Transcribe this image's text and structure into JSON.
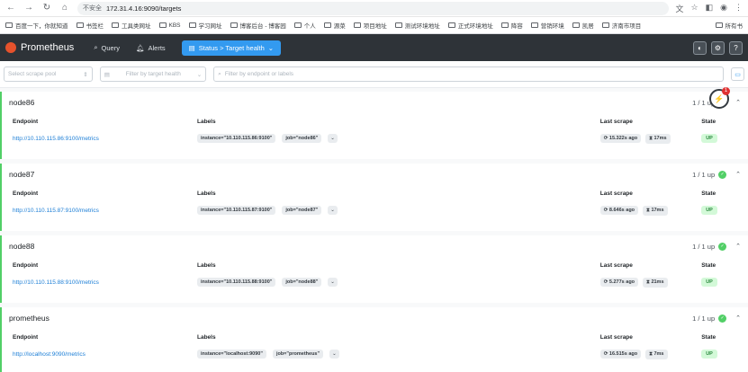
{
  "browser": {
    "url_warning": "不安全",
    "url": "172.31.4.16:9090/targets",
    "bookmarks": [
      "百度一下，你就知道",
      "书签栏",
      "工具类网址",
      "KBS",
      "学习网址",
      "博客后台 - 博客园",
      "个人",
      "源菜",
      "项目地址",
      "测试环境地址",
      "正式环境地址",
      "降容",
      "营销环境",
      "凯居",
      "济南市项目"
    ],
    "bookmarks_right": "所有书"
  },
  "navbar": {
    "brand": "Prometheus",
    "query": "Query",
    "alerts": "Alerts",
    "status": "Status > Target health"
  },
  "filters": {
    "scrape_pool_placeholder": "Select scrape pool",
    "health_placeholder": "Filter by target health",
    "search_placeholder": "Filter by endpoint or labels"
  },
  "columns": {
    "endpoint": "Endpoint",
    "labels": "Labels",
    "last_scrape": "Last scrape",
    "state": "State"
  },
  "pools": [
    {
      "name": "node86",
      "count": "1 / 1 up",
      "endpoint": "http://10.110.115.86:9100/metrics",
      "instance": "instance=\"10.110.115.86:9100\"",
      "job": "job=\"node86\"",
      "ago": "15.322s ago",
      "dur": "17ms",
      "state": "UP"
    },
    {
      "name": "node87",
      "count": "1 / 1 up",
      "endpoint": "http://10.110.115.87:9100/metrics",
      "instance": "instance=\"10.110.115.87:9100\"",
      "job": "job=\"node87\"",
      "ago": "8.646s ago",
      "dur": "17ms",
      "state": "UP"
    },
    {
      "name": "node88",
      "count": "1 / 1 up",
      "endpoint": "http://10.110.115.88:9100/metrics",
      "instance": "instance=\"10.110.115.88:9100\"",
      "job": "job=\"node88\"",
      "ago": "5.277s ago",
      "dur": "21ms",
      "state": "UP"
    },
    {
      "name": "prometheus",
      "count": "1 / 1 up",
      "endpoint": "http://localhost:9090/metrics",
      "instance": "instance=\"localhost:9090\"",
      "job": "job=\"prometheus\"",
      "ago": "16.515s ago",
      "dur": "7ms",
      "state": "UP"
    }
  ],
  "floating_badge": "1",
  "colors": {
    "navbar": "#2e3338",
    "accent": "#339af0",
    "healthy": "#51cf66"
  }
}
